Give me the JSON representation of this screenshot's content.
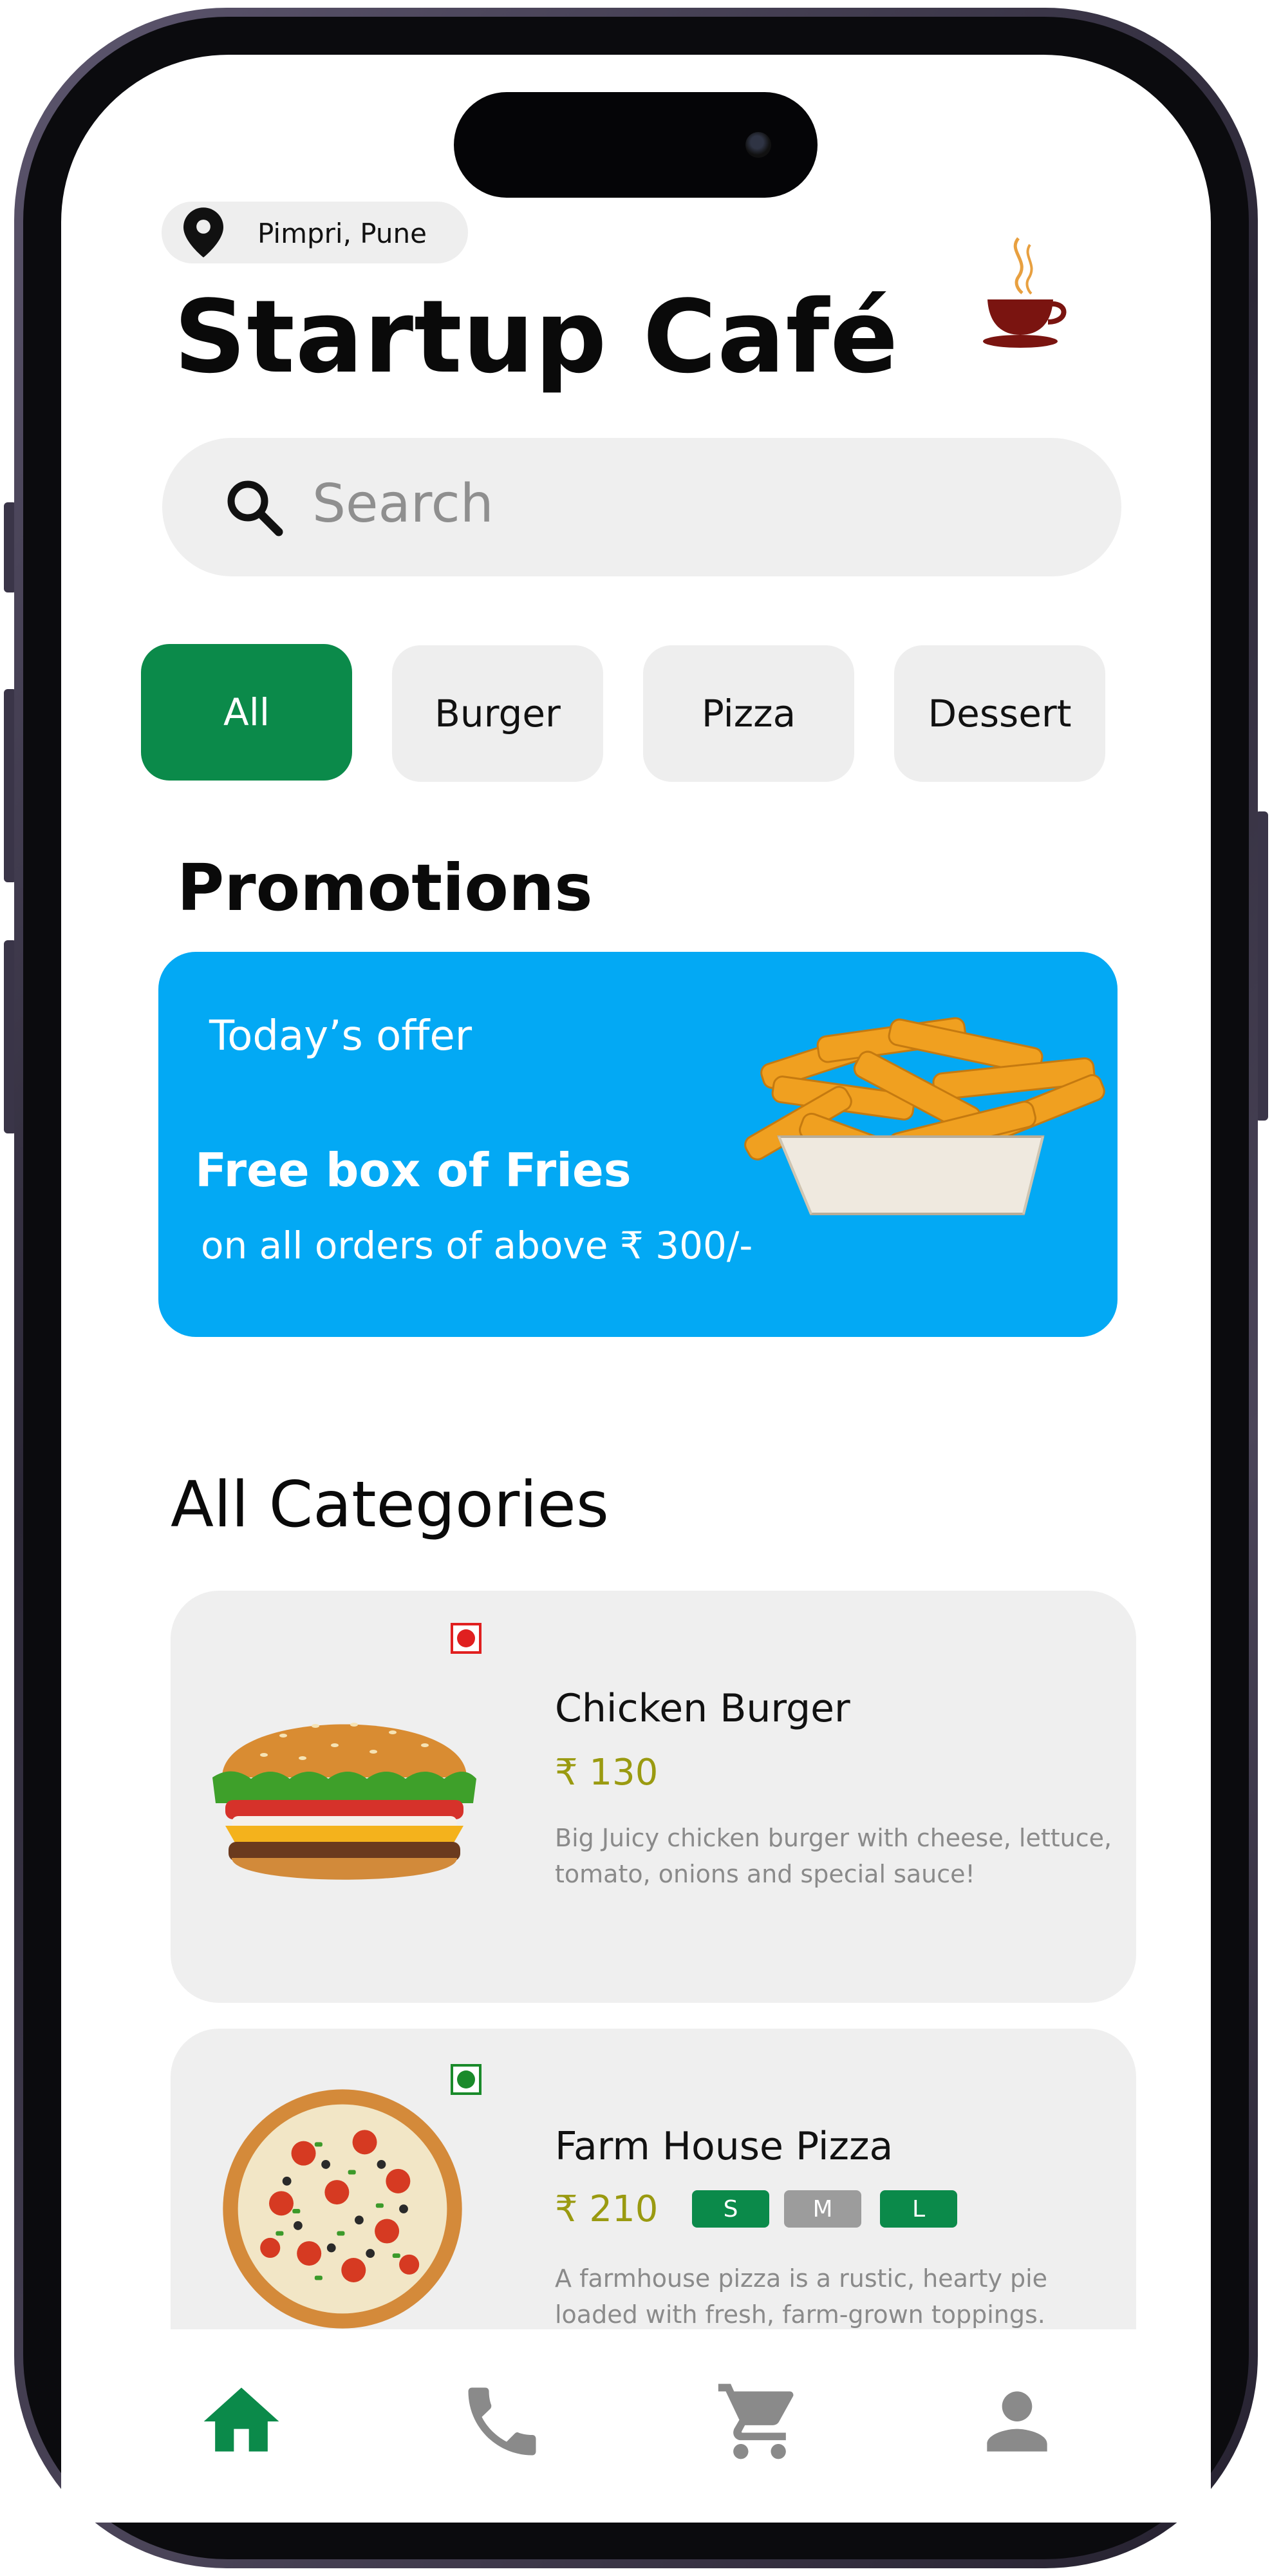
{
  "header": {
    "location": "Pimpri, Pune",
    "title": "Startup Café"
  },
  "search": {
    "placeholder": "Search"
  },
  "filters": [
    {
      "label": "All",
      "active": true
    },
    {
      "label": "Burger",
      "active": false
    },
    {
      "label": "Pizza",
      "active": false
    },
    {
      "label": "Dessert",
      "active": false
    }
  ],
  "promotions": {
    "heading": "Promotions",
    "offer_label": "Today’s offer",
    "offer_title": "Free box of Fries",
    "offer_subtitle": "on all orders of above  ₹ 300/-"
  },
  "categories": {
    "heading": "All Categories",
    "items": [
      {
        "name": "Chicken Burger",
        "price": "₹ 130",
        "description": "Big Juicy chicken burger with cheese, lettuce, tomato, onions and special sauce!",
        "diet": "non-veg"
      },
      {
        "name": "Farm House Pizza",
        "price": "₹ 210",
        "description": "A farmhouse pizza is a rustic, hearty pie loaded with fresh, farm-grown toppings.",
        "diet": "veg",
        "sizes": [
          "S",
          "M",
          "L"
        ]
      }
    ]
  },
  "bottom_nav": {
    "items": [
      "home-icon",
      "phone-icon",
      "cart-icon",
      "profile-icon"
    ],
    "active": "home-icon"
  },
  "colors": {
    "accent_green": "#0b8a4a",
    "promo_blue": "#03a9f4",
    "price_olive": "#9a9a10",
    "non_veg_red": "#e02020",
    "inactive_icon": "#8a8a8a"
  }
}
